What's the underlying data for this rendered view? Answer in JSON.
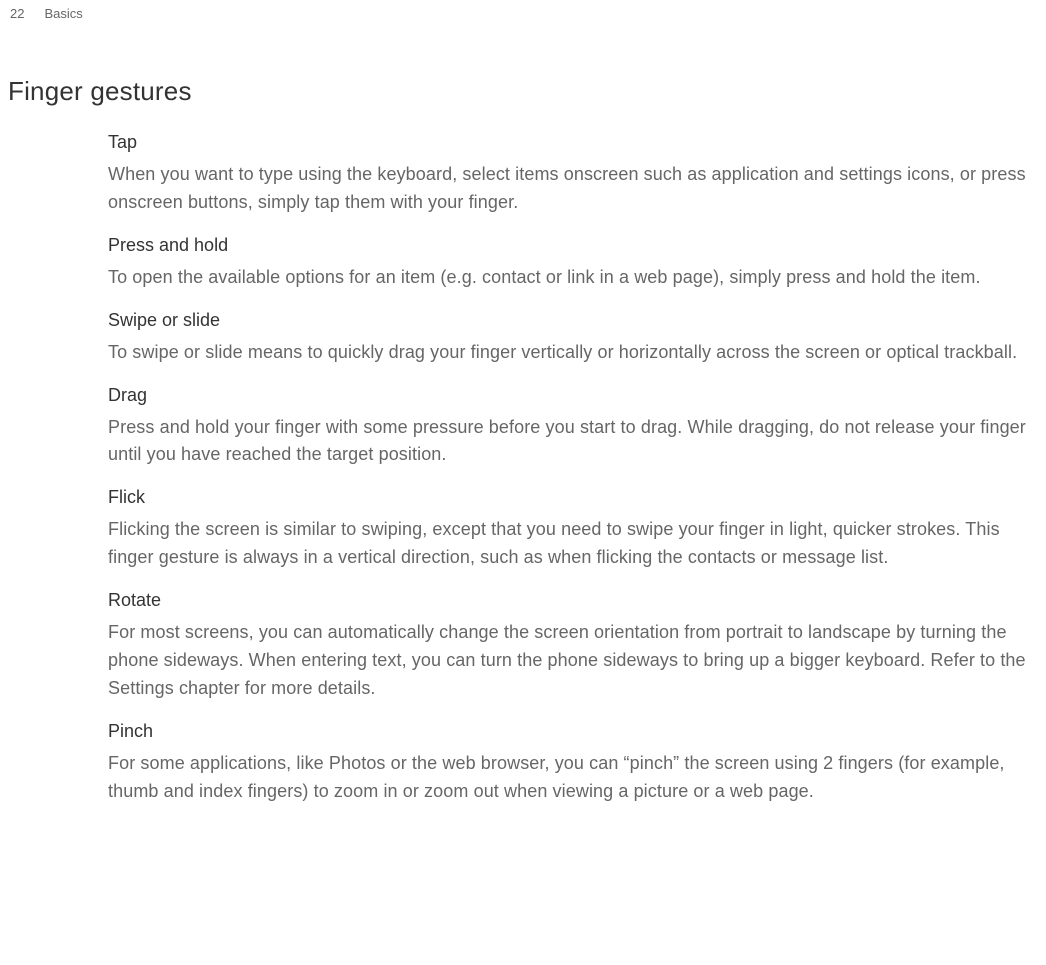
{
  "header": {
    "page_number": "22",
    "chapter": "Basics"
  },
  "title": "Finger gestures",
  "sections": [
    {
      "title": "Tap",
      "body": "When you want to type using the keyboard, select items onscreen such as application and settings icons, or press onscreen buttons, simply tap them with your finger."
    },
    {
      "title": "Press and hold",
      "body": "To open the available options for an item (e.g. contact or link in a web page), simply press and hold the item."
    },
    {
      "title": "Swipe or slide",
      "body": "To swipe or slide means to quickly drag your finger vertically or horizontally across the screen or optical trackball."
    },
    {
      "title": "Drag",
      "body": "Press and hold your finger with some pressure before you start to drag. While dragging, do not release your finger until you have reached the target position."
    },
    {
      "title": "Flick",
      "body": "Flicking the screen is similar to swiping, except that you need to swipe your finger in light, quicker strokes. This finger gesture is always in a vertical direction, such as when flicking the contacts or message list."
    },
    {
      "title": "Rotate",
      "body": "For most screens, you can automatically change the screen orientation from portrait to landscape by turning the phone sideways. When entering text, you can turn the phone sideways to bring up a bigger keyboard. Refer to the Settings chapter for more details."
    },
    {
      "title": "Pinch",
      "body": "For some applications, like Photos or the web browser, you can “pinch” the screen using 2 fingers (for example, thumb and index fingers) to zoom in or zoom out when viewing a picture or a web page."
    }
  ]
}
